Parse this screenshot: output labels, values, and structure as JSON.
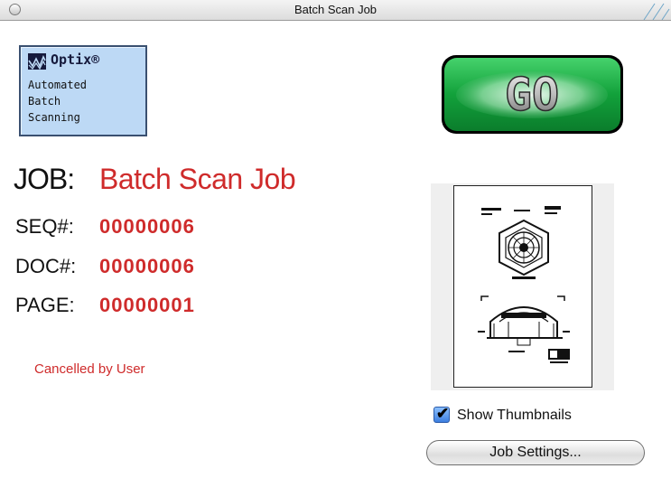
{
  "window": {
    "title": "Batch Scan Job"
  },
  "logo": {
    "brand": "Optix®",
    "lines": [
      "Automated",
      "Batch",
      "Scanning"
    ]
  },
  "go_button": {
    "label": "GO"
  },
  "job": {
    "job_label": "JOB:",
    "job_value": "Batch Scan Job",
    "seq_label": "SEQ#:",
    "seq_value": "00000006",
    "doc_label": "DOC#:",
    "doc_value": "00000006",
    "page_label": "PAGE:",
    "page_value": "00000001"
  },
  "status": {
    "text": "Cancelled by User"
  },
  "thumbnails": {
    "label": "Show Thumbnails",
    "checked": true
  },
  "settings_button": {
    "label": "Job Settings..."
  },
  "colors": {
    "value_red": "#cf2b2b",
    "go_green": "#17a33e",
    "logo_blue": "#bdd9f5",
    "checkbox_blue": "#3d7fe0"
  }
}
